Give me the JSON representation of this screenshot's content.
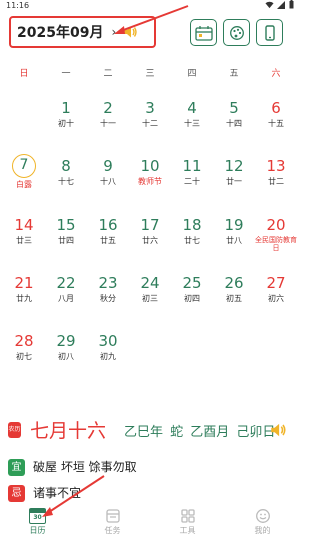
{
  "status_bar": {
    "time": "11:16"
  },
  "header": {
    "month_label": "2025年09月",
    "chevron": "›"
  },
  "weekdays": [
    "日",
    "一",
    "二",
    "三",
    "四",
    "五",
    "六"
  ],
  "calendar": {
    "days": [
      {
        "num": "",
        "sub": ""
      },
      {
        "num": "1",
        "sub": "初十"
      },
      {
        "num": "2",
        "sub": "十一"
      },
      {
        "num": "3",
        "sub": "十二"
      },
      {
        "num": "4",
        "sub": "十三"
      },
      {
        "num": "5",
        "sub": "十四"
      },
      {
        "num": "6",
        "sub": "十五"
      },
      {
        "num": "7",
        "sub": "白露",
        "sub_red": true,
        "today": true
      },
      {
        "num": "8",
        "sub": "十七"
      },
      {
        "num": "9",
        "sub": "十八"
      },
      {
        "num": "10",
        "sub": "教师节",
        "sub_red": true
      },
      {
        "num": "11",
        "sub": "二十"
      },
      {
        "num": "12",
        "sub": "廿一"
      },
      {
        "num": "13",
        "sub": "廿二"
      },
      {
        "num": "14",
        "sub": "廿三"
      },
      {
        "num": "15",
        "sub": "廿四"
      },
      {
        "num": "16",
        "sub": "廿五"
      },
      {
        "num": "17",
        "sub": "廿六"
      },
      {
        "num": "18",
        "sub": "廿七"
      },
      {
        "num": "19",
        "sub": "廿八"
      },
      {
        "num": "20",
        "sub": "全民国防教育日",
        "sub_red": true,
        "small": true
      },
      {
        "num": "21",
        "sub": "廿九"
      },
      {
        "num": "22",
        "sub": "八月"
      },
      {
        "num": "23",
        "sub": "秋分"
      },
      {
        "num": "24",
        "sub": "初三"
      },
      {
        "num": "25",
        "sub": "初四"
      },
      {
        "num": "26",
        "sub": "初五"
      },
      {
        "num": "27",
        "sub": "初六"
      },
      {
        "num": "28",
        "sub": "初七"
      },
      {
        "num": "29",
        "sub": "初八"
      },
      {
        "num": "30",
        "sub": "初九"
      }
    ]
  },
  "info": {
    "lunar_tag": "农历",
    "lunar_date": "七月十六",
    "ganzhi": "乙巳年 蛇 乙酉月 己卯日",
    "yi_tag": "宜",
    "yi_text": "破屋 坏垣 馀事勿取",
    "ji_tag": "忌",
    "ji_text": "诸事不宜"
  },
  "nav": {
    "items": [
      {
        "label": "日历",
        "icon": "calendar-30-icon",
        "active": true,
        "icon_text": "30",
        "icon_top": "星期日"
      },
      {
        "label": "任务",
        "icon": "task-icon"
      },
      {
        "label": "工具",
        "icon": "grid-icon"
      },
      {
        "label": "我的",
        "icon": "smiley-icon"
      }
    ]
  },
  "colors": {
    "accent": "#2e7d5b",
    "red": "#e53935",
    "highlight": "#f0b429"
  }
}
